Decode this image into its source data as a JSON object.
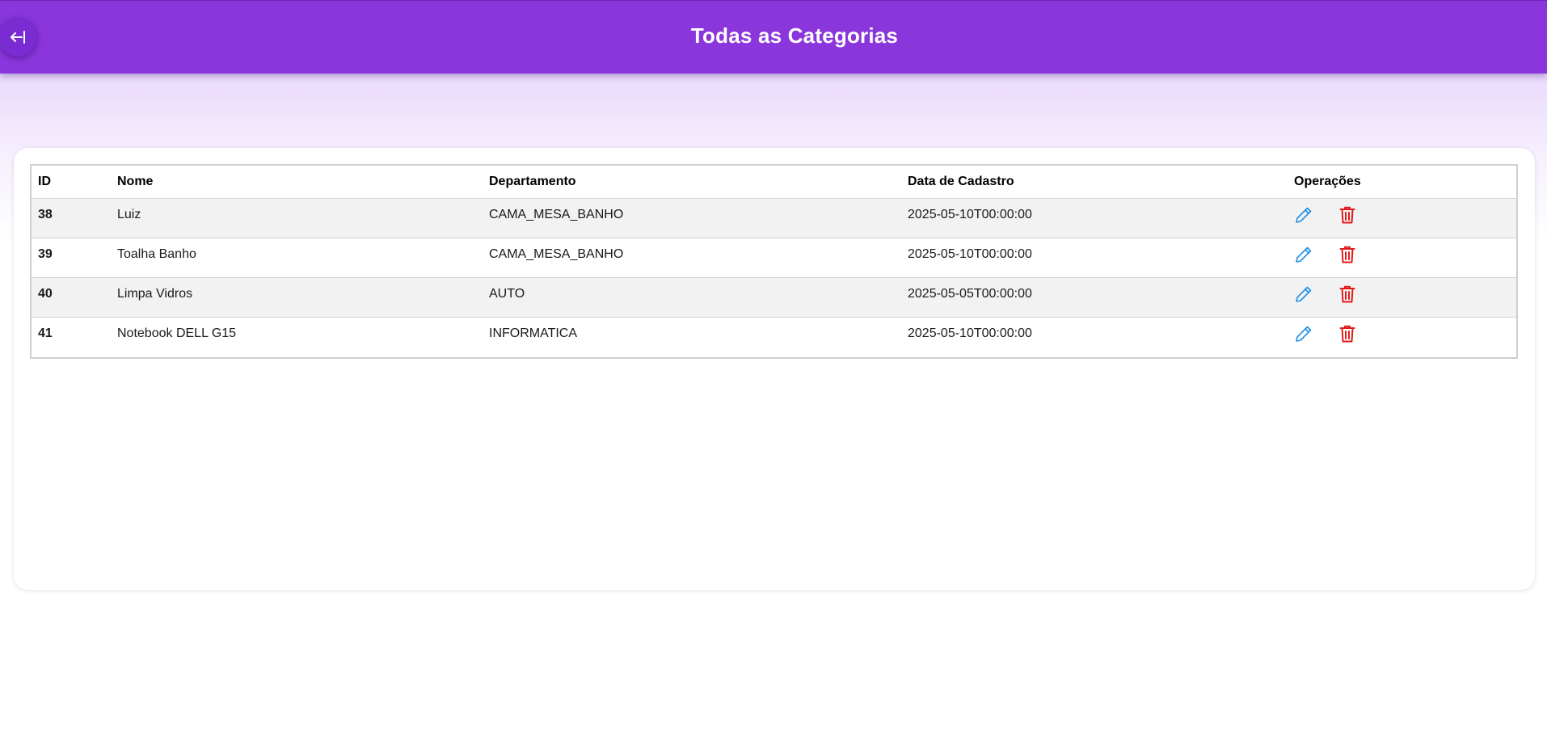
{
  "header": {
    "title": "Todas as Categorias",
    "back_icon": "arrow-left-to-bar-icon",
    "background": "#8a36dc"
  },
  "table": {
    "columns": [
      "ID",
      "Nome",
      "Departamento",
      "Data de Cadastro",
      "Operações"
    ],
    "rows": [
      {
        "id": "38",
        "nome": "Luiz",
        "departamento": "CAMA_MESA_BANHO",
        "data_cadastro": "2025-05-10T00:00:00"
      },
      {
        "id": "39",
        "nome": "Toalha Banho",
        "departamento": "CAMA_MESA_BANHO",
        "data_cadastro": "2025-05-10T00:00:00"
      },
      {
        "id": "40",
        "nome": "Limpa Vidros",
        "departamento": "AUTO",
        "data_cadastro": "2025-05-05T00:00:00"
      },
      {
        "id": "41",
        "nome": "Notebook DELL G15",
        "departamento": "INFORMATICA",
        "data_cadastro": "2025-05-10T00:00:00"
      }
    ],
    "operations": {
      "edit_icon": "pencil-icon",
      "delete_icon": "trash-icon",
      "edit_color": "#1e90e8",
      "delete_color": "#e01b1b"
    }
  }
}
